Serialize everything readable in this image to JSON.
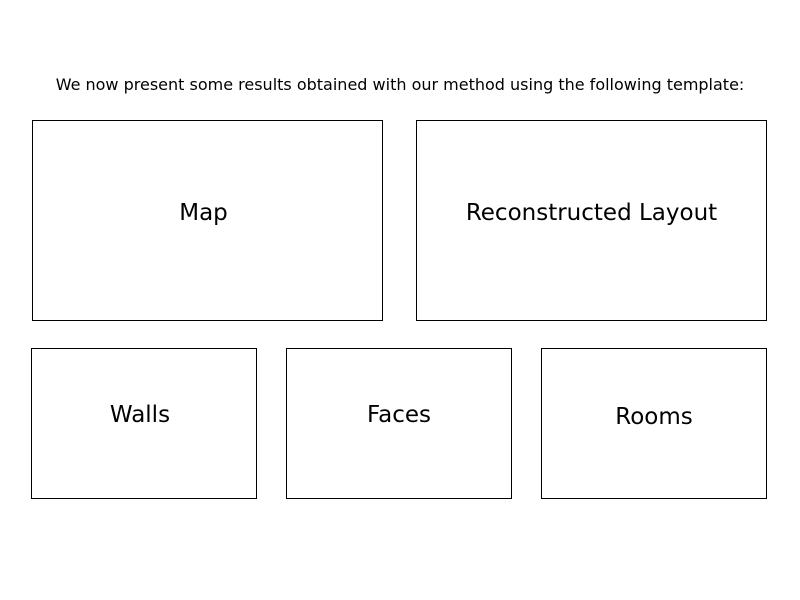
{
  "caption": "We now present some results obtained with our method using the following template:",
  "top_row": {
    "map_label": "Map",
    "layout_label": "Reconstructed Layout"
  },
  "bottom_row": {
    "walls_label": "Walls",
    "faces_label": "Faces",
    "rooms_label": "Rooms"
  }
}
